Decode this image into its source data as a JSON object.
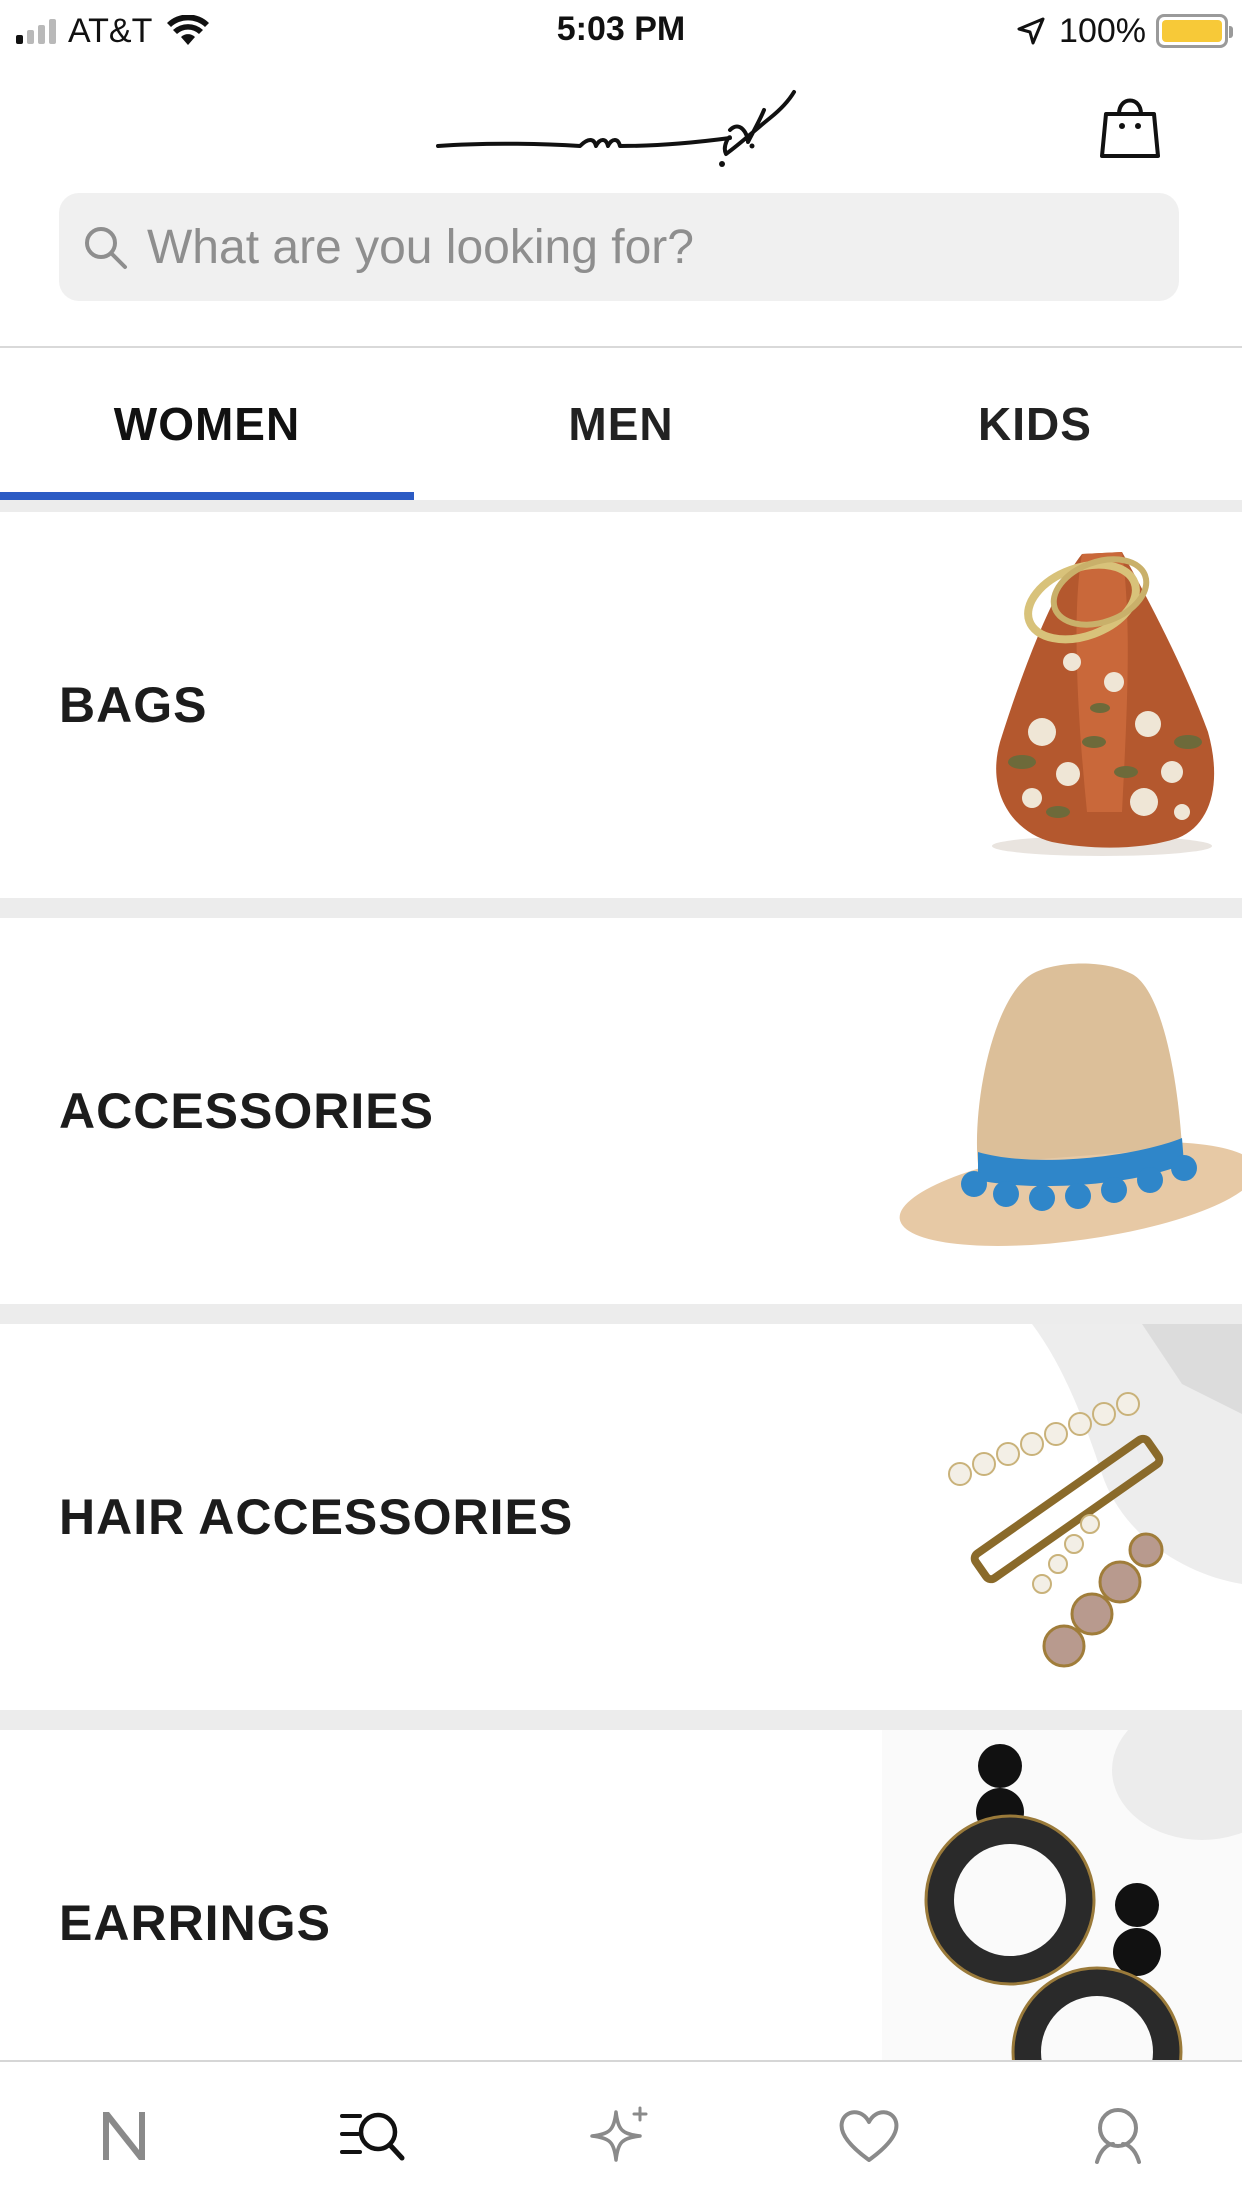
{
  "status_bar": {
    "carrier": "AT&T",
    "time": "5:03 PM",
    "battery": "100%",
    "battery_color": "#f7c938"
  },
  "header": {
    "logo_icon": "signature-logo",
    "bag_icon": "shopping-bag-icon"
  },
  "search": {
    "placeholder": "What are you looking for?"
  },
  "tabs": [
    {
      "label": "WOMEN",
      "active": true
    },
    {
      "label": "MEN",
      "active": false
    },
    {
      "label": "KIDS",
      "active": false
    }
  ],
  "accent_color": "#2c5bc4",
  "categories": [
    {
      "label": "BAGS",
      "image": "embroidered-potli-bag"
    },
    {
      "label": "ACCESSORIES",
      "image": "straw-hat-blue-pompom"
    },
    {
      "label": "HAIR ACCESSORIES",
      "image": "pearl-hair-clips"
    },
    {
      "label": "EARRINGS",
      "image": "black-hoop-earrings"
    }
  ],
  "bottom_nav": [
    {
      "icon": "n-logo-icon"
    },
    {
      "icon": "browse-search-icon",
      "active": true
    },
    {
      "icon": "sparkle-icon"
    },
    {
      "icon": "heart-icon"
    },
    {
      "icon": "profile-icon"
    }
  ]
}
